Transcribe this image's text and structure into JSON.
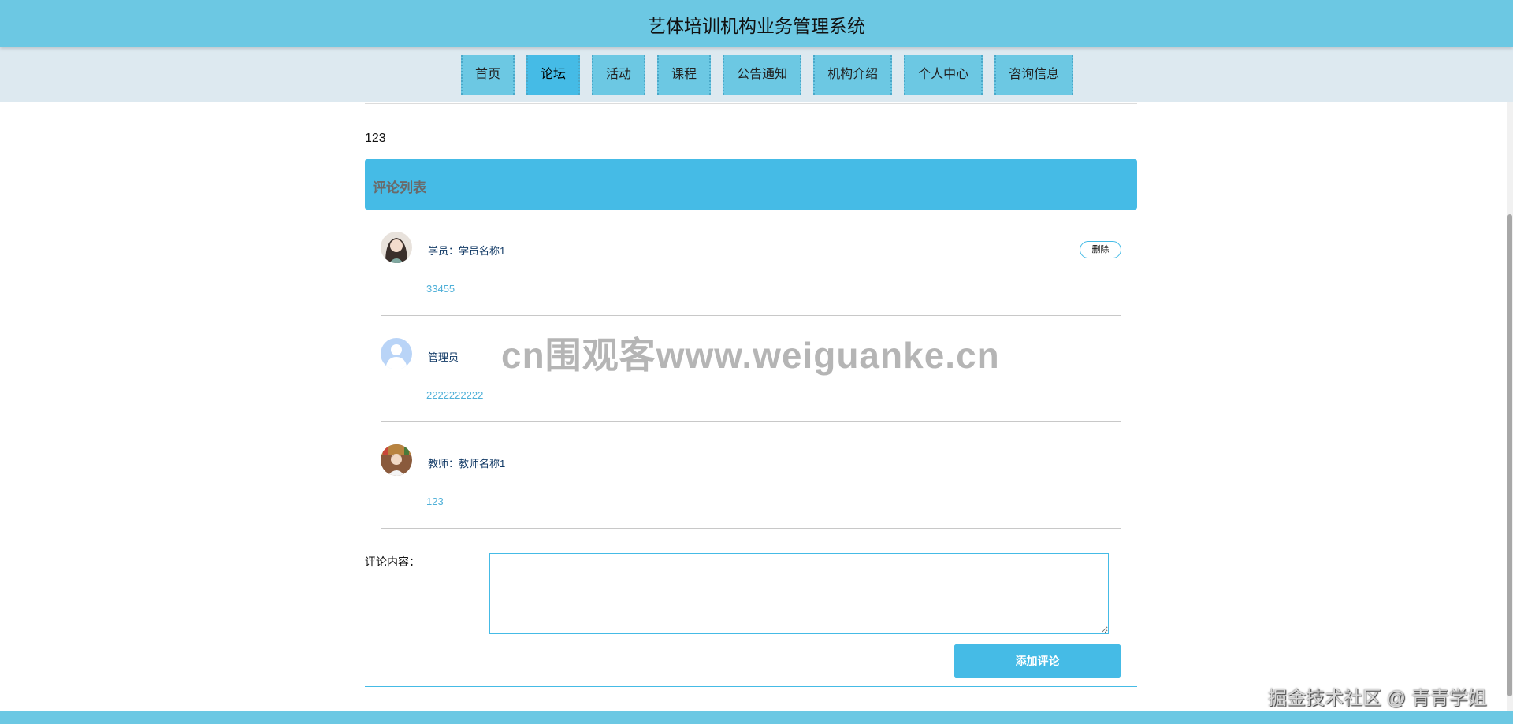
{
  "header": {
    "title": "艺体培训机构业务管理系统"
  },
  "nav": {
    "items": [
      {
        "label": "首页",
        "icon": ""
      },
      {
        "label": "论坛",
        "active": true
      },
      {
        "label": "活动"
      },
      {
        "label": "课程"
      },
      {
        "label": "公告通知"
      },
      {
        "label": "机构介绍"
      },
      {
        "label": "个人中心"
      },
      {
        "label": "咨询信息"
      }
    ]
  },
  "post": {
    "content": "123"
  },
  "comments_section": {
    "title": "评论列表",
    "delete_label": "删除",
    "items": [
      {
        "author": "学员：学员名称1",
        "text": "33455",
        "avatar": "student-avatar"
      },
      {
        "author": "管理员",
        "text": "2222222222",
        "avatar": "default-user-avatar"
      },
      {
        "author": "教师：教师名称1",
        "text": "123",
        "avatar": "teacher-avatar"
      }
    ]
  },
  "form": {
    "label": "评论内容：",
    "value": "",
    "placeholder": "",
    "submit_label": "添加评论"
  },
  "watermarks": {
    "center": "cn围观客www.weiguanke.cn",
    "corner": "掘金技术社区 @ 青青学姐"
  },
  "colors": {
    "primary": "#45bbe6",
    "topbar": "#6cc8e3",
    "navbar_bg": "#dde9f0"
  }
}
